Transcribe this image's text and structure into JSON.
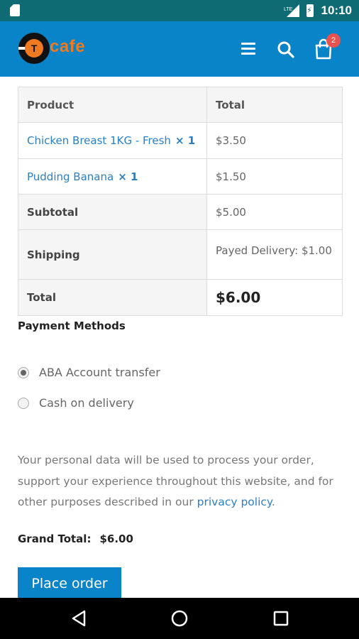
{
  "status_bar": {
    "network": "LTE",
    "time": "10:10"
  },
  "header": {
    "logo_letter": "T",
    "logo_word": "cafe",
    "cart_count": "2",
    "icons": [
      "menu-icon",
      "search-icon",
      "cart-icon"
    ]
  },
  "order_table": {
    "headers": [
      "Product",
      "Total"
    ],
    "items": [
      {
        "name": "Chicken Breast 1KG - Fresh",
        "qty": "× 1",
        "total": "$3.50"
      },
      {
        "name": "Pudding Banana",
        "qty": "× 1",
        "total": "$1.50"
      }
    ],
    "subtotal_label": "Subtotal",
    "subtotal_value": "$5.00",
    "shipping_label": "Shipping",
    "shipping_value": "Payed Delivery: $1.00",
    "total_label": "Total",
    "total_value": "$6.00"
  },
  "payment": {
    "heading": "Payment Methods",
    "options": [
      {
        "label": "ABA Account transfer",
        "selected": true
      },
      {
        "label": "Cash on delivery",
        "selected": false
      }
    ]
  },
  "privacy": {
    "text": "Your personal data will be used to process your order, support your experience throughout this website, and for other purposes described in our ",
    "link": "privacy policy",
    "end": "."
  },
  "grand_total": {
    "label": "Grand Total:",
    "value": "$6.00"
  },
  "place_order_label": "Place order",
  "colors": {
    "status_bar": "#0e6b73",
    "app_bar": "#0a84c8",
    "accent_orange": "#f07a22",
    "link_blue": "#2a7fc4",
    "badge_red": "#e9534f"
  }
}
